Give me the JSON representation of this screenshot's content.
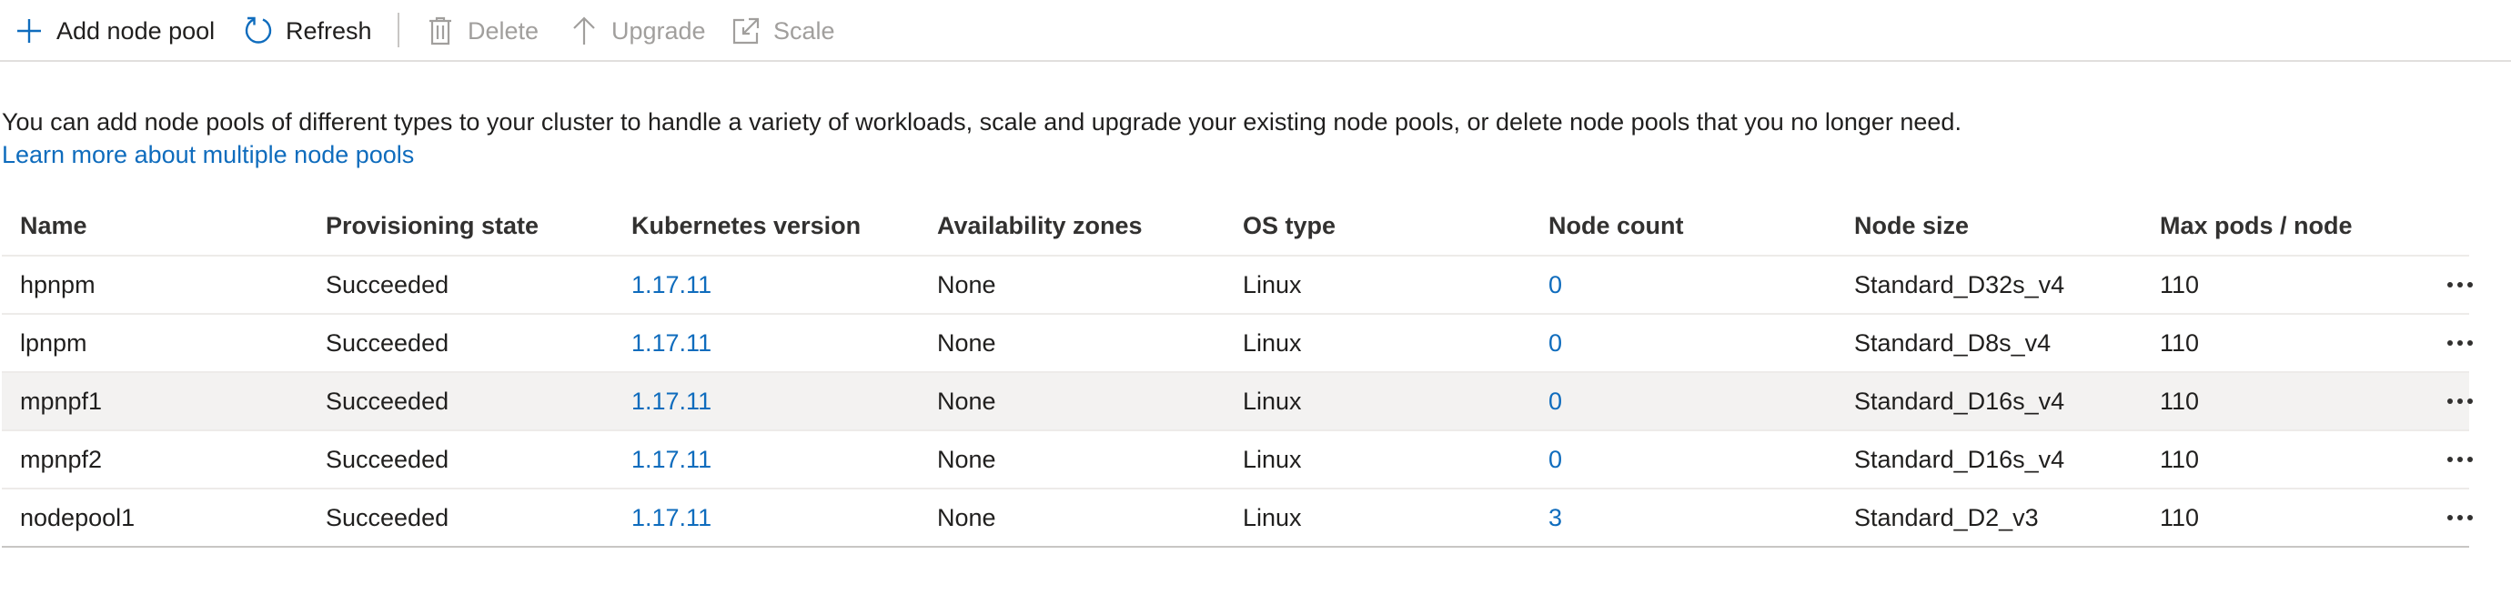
{
  "toolbar": {
    "add_label": "Add node pool",
    "refresh_label": "Refresh",
    "delete_label": "Delete",
    "upgrade_label": "Upgrade",
    "scale_label": "Scale"
  },
  "description": "You can add node pools of different types to your cluster to handle a variety of workloads, scale and upgrade your existing node pools, or delete node pools that you no longer need.",
  "learn_more": "Learn more about multiple node pools",
  "table": {
    "columns": [
      "Name",
      "Provisioning state",
      "Kubernetes version",
      "Availability zones",
      "OS type",
      "Node count",
      "Node size",
      "Max pods / node"
    ],
    "rows": [
      {
        "name": "hpnpm",
        "state": "Succeeded",
        "version": "1.17.11",
        "zones": "None",
        "os": "Linux",
        "count": "0",
        "size": "Standard_D32s_v4",
        "max_pods": "110"
      },
      {
        "name": "lpnpm",
        "state": "Succeeded",
        "version": "1.17.11",
        "zones": "None",
        "os": "Linux",
        "count": "0",
        "size": "Standard_D8s_v4",
        "max_pods": "110"
      },
      {
        "name": "mpnpf1",
        "state": "Succeeded",
        "version": "1.17.11",
        "zones": "None",
        "os": "Linux",
        "count": "0",
        "size": "Standard_D16s_v4",
        "max_pods": "110"
      },
      {
        "name": "mpnpf2",
        "state": "Succeeded",
        "version": "1.17.11",
        "zones": "None",
        "os": "Linux",
        "count": "0",
        "size": "Standard_D16s_v4",
        "max_pods": "110"
      },
      {
        "name": "nodepool1",
        "state": "Succeeded",
        "version": "1.17.11",
        "zones": "None",
        "os": "Linux",
        "count": "3",
        "size": "Standard_D2_v3",
        "max_pods": "110"
      }
    ],
    "selected_row": 2
  },
  "icons": {
    "add": "plus-icon",
    "refresh": "refresh-icon",
    "delete": "trash-icon",
    "upgrade": "arrow-up-icon",
    "scale": "scale-icon",
    "row_menu": "more-icon"
  },
  "colors": {
    "accent": "#0f6cbd",
    "disabled": "#a19f9d",
    "selected_row": "#f3f2f1"
  }
}
